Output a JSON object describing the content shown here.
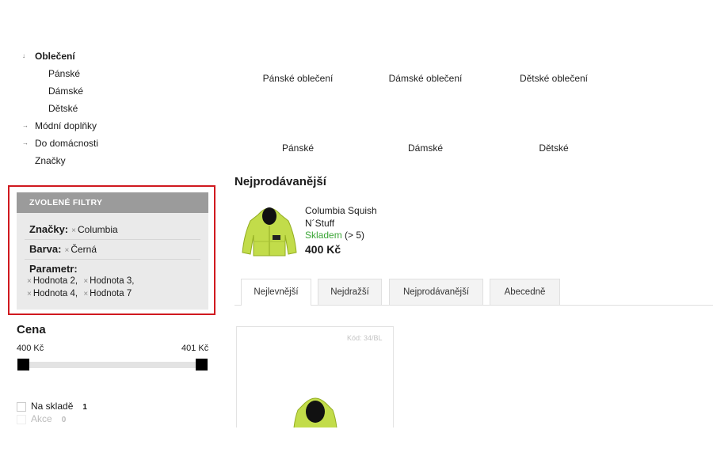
{
  "sidebar": {
    "tree": [
      {
        "label": "Oblečení",
        "arrow": "↓",
        "level": 0,
        "bold": true
      },
      {
        "label": "Pánské",
        "arrow": "",
        "level": 1,
        "bold": false
      },
      {
        "label": "Dámské",
        "arrow": "",
        "level": 1,
        "bold": false
      },
      {
        "label": "Dětské",
        "arrow": "",
        "level": 1,
        "bold": false
      },
      {
        "label": "Módní doplňky",
        "arrow": "→",
        "level": 0,
        "bold": false
      },
      {
        "label": "Do domácnosti",
        "arrow": "→",
        "level": 0,
        "bold": false
      },
      {
        "label": "Značky",
        "arrow": "",
        "level": 0,
        "bold": false
      }
    ],
    "filters": {
      "heading": "ZVOLENÉ FILTRY",
      "brand_label": "Značky:",
      "brand_value": "Columbia",
      "color_label": "Barva:",
      "color_value": "Černá",
      "param_label": "Parametr:",
      "param_values": [
        "Hodnota 2,",
        "Hodnota 3,",
        "Hodnota 4,",
        "Hodnota 7"
      ],
      "remove_symbol": "×",
      "outline_color": "#d0191f"
    },
    "price": {
      "title": "Cena",
      "min": "400 Kč",
      "max": "401 Kč"
    },
    "checkboxes": [
      {
        "label": "Na skladě",
        "count": "1",
        "enabled": true
      },
      {
        "label": "Akce",
        "count": "0",
        "enabled": false
      }
    ]
  },
  "categories": {
    "top_row": [
      "Pánské oblečení",
      "Dámské oblečení",
      "Dětské oblečení"
    ],
    "second_row": [
      "Pánské",
      "Dámské",
      "Dětské"
    ]
  },
  "bestsellers": {
    "title": "Nejprodávanější",
    "product": {
      "name_line1": "Columbia Squish",
      "name_line2": "N´Stuff",
      "stock_status": "Skladem",
      "stock_count": "(> 5)",
      "price": "400 Kč",
      "jacket_color": "#c2dc4a",
      "stock_color": "#3aa535"
    }
  },
  "tabs": {
    "items": [
      "Nejlevnější",
      "Nejdražší",
      "Nejprodávanější",
      "Abecedně"
    ],
    "active": "Nejlevnější"
  },
  "product_card": {
    "code": "Kód: 34/BL"
  }
}
